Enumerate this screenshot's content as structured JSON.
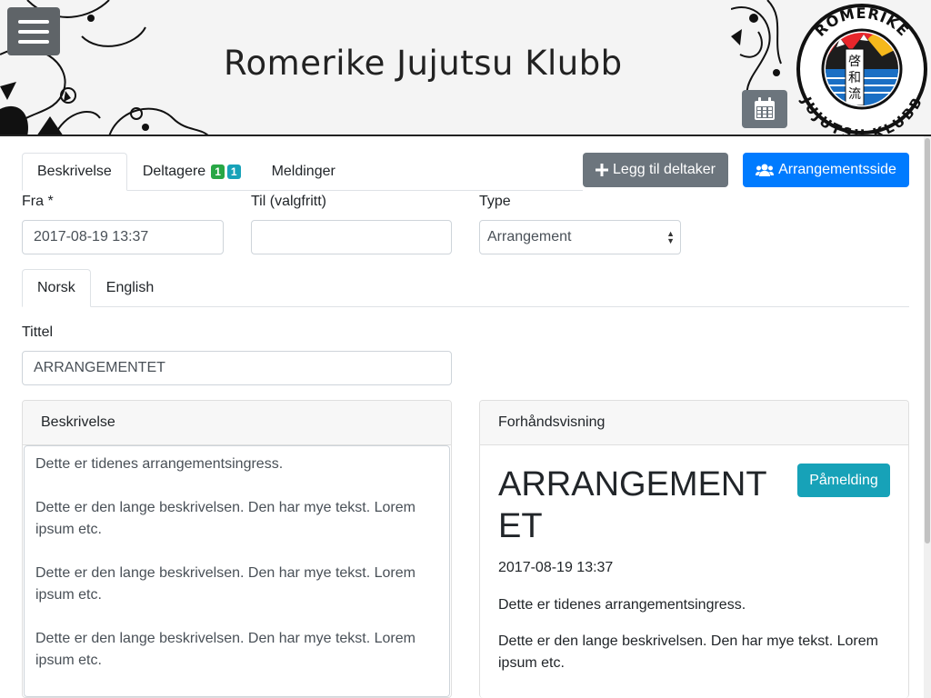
{
  "header": {
    "site_title": "Romerike Jujutsu Klubb",
    "logo_top_text": "ROMERIKE",
    "logo_bottom_text": "JUJUTSU KLUBB",
    "logo_kanji": [
      "啓",
      "和",
      "流"
    ]
  },
  "tabs_main": [
    {
      "label": "Beskrivelse",
      "active": true
    },
    {
      "label": "Deltagere",
      "badges": [
        "1",
        "1"
      ],
      "active": false
    },
    {
      "label": "Meldinger",
      "active": false
    }
  ],
  "actions": {
    "add_participant_label": "Legg til deltaker",
    "event_page_label": "Arrangementsside"
  },
  "form": {
    "from_label": "Fra *",
    "from_value": "2017-08-19 13:37",
    "to_label": "Til (valgfritt)",
    "to_value": "",
    "type_label": "Type",
    "type_value": "Arrangement",
    "title_label": "Tittel",
    "title_value": "ARRANGEMENTET"
  },
  "tabs_lang": [
    {
      "label": "Norsk",
      "active": true
    },
    {
      "label": "English",
      "active": false
    }
  ],
  "description_card": {
    "header": "Beskrivelse",
    "paragraphs": [
      "Dette er tidenes arrangementsingress.",
      "Dette er den lange beskrivelsen. Den har mye tekst. Lorem ipsum etc.",
      "Dette er den lange beskrivelsen. Den har mye tekst. Lorem ipsum etc.",
      "Dette er den lange beskrivelsen. Den har mye tekst. Lorem ipsum etc."
    ]
  },
  "preview_card": {
    "header": "Forhåndsvisning",
    "title": "ARRANGEMENTET",
    "signup_label": "Påmelding",
    "date": "2017-08-19 13:37",
    "paragraphs": [
      "Dette er tidenes arrangementsingress.",
      "Dette er den lange beskrivelsen. Den har mye tekst. Lorem ipsum etc."
    ]
  },
  "colors": {
    "primary": "#007bff",
    "secondary": "#6c757d",
    "info": "#17a2b8",
    "success": "#28a745"
  },
  "icons": [
    "menu-icon",
    "calendar-icon",
    "plus-icon",
    "users-icon"
  ]
}
